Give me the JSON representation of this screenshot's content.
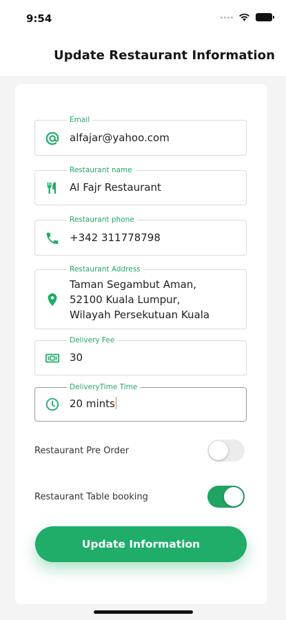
{
  "status_bar": {
    "time": "9:54"
  },
  "header": {
    "title": "Update Restaurant Information"
  },
  "form": {
    "fields": [
      {
        "label": "Email",
        "value": "alfajar@yahoo.com",
        "icon": "at-icon"
      },
      {
        "label": "Restaurant name",
        "value": "Al Fajr Restaurant",
        "icon": "utensils-icon"
      },
      {
        "label": "Restaurant phone",
        "value": "+342 311778798",
        "icon": "phone-icon"
      },
      {
        "label": "Restaurant Address",
        "value": "Taman Segambut Aman,\n52100 Kuala Lumpur,\nWilayah Persekutuan Kuala",
        "icon": "location-pin-icon"
      },
      {
        "label": "Delivery Fee",
        "value": "30",
        "icon": "money-icon"
      },
      {
        "label": "DeliveryTime Time",
        "value": "20 mints",
        "icon": "clock-icon"
      }
    ],
    "toggles": [
      {
        "label": "Restaurant Pre Order",
        "on": false
      },
      {
        "label": "Restaurant Table booking",
        "on": true
      }
    ],
    "submit_label": "Update Information"
  },
  "colors": {
    "accent": "#1fad69",
    "label": "#23a566"
  }
}
